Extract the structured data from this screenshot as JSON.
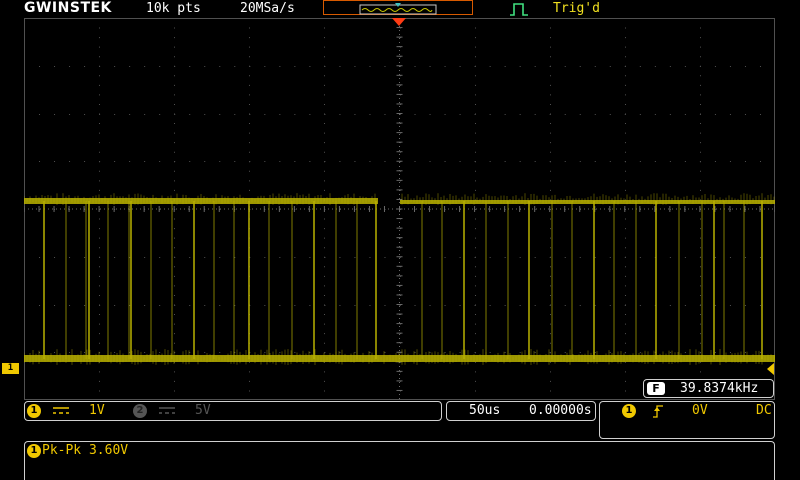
{
  "header": {
    "brand": "GWINSTEK",
    "record_length": "10k pts",
    "sample_rate": "20MSa/s",
    "trigger_status": "Trig'd"
  },
  "channel_marker": {
    "label": "1"
  },
  "frequency": {
    "label": "F",
    "value": "39.8374kHz"
  },
  "channels": {
    "ch1": {
      "number": "1",
      "scale": "1V",
      "coupling_icon": "dc-coupling-icon"
    },
    "ch2": {
      "number": "2",
      "scale": "5V",
      "coupling_icon": "dc-coupling-icon"
    }
  },
  "timebase": {
    "scale": "50us",
    "position": "0.00000s"
  },
  "trigger": {
    "source": "1",
    "slope_icon": "rising-edge-icon",
    "level": "0V",
    "coupling": "DC"
  },
  "measurement": {
    "channel": "1",
    "text": "Pk-Pk 3.60V"
  },
  "colors": {
    "ch1": "#f0c800",
    "trace": "#b8b000",
    "grid": "#505050",
    "trigger_marker": "#ff3c14",
    "trig_text": "#f0e020",
    "memory_box": "#d75a00",
    "trigger_icon": "#40e080"
  }
}
